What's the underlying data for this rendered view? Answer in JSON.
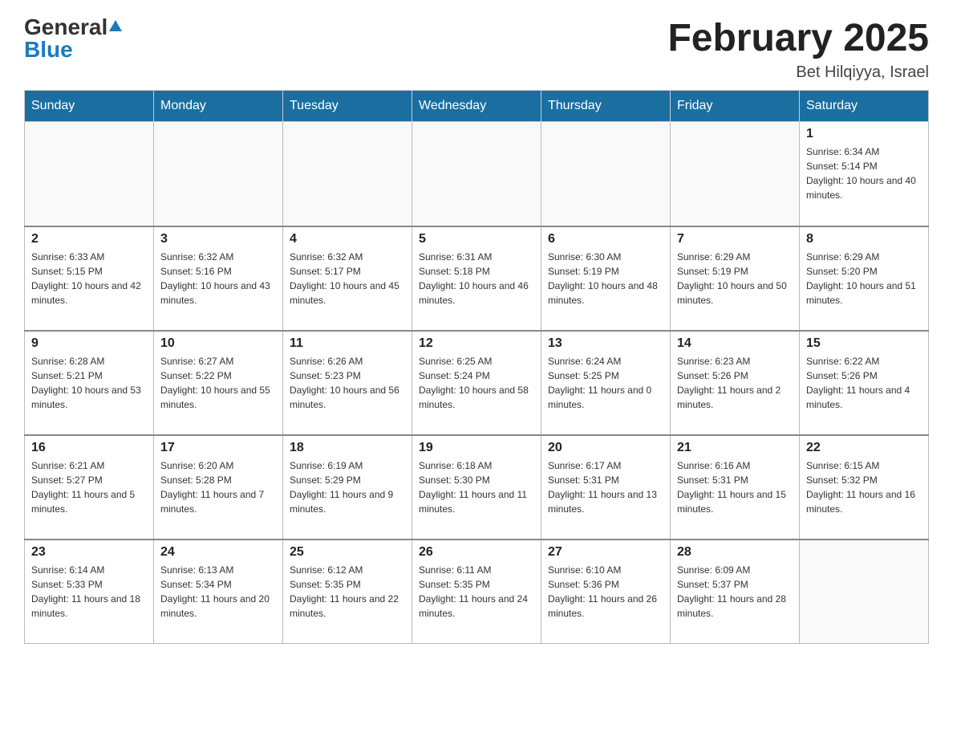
{
  "header": {
    "logo_general": "General",
    "logo_blue": "Blue",
    "month_title": "February 2025",
    "location": "Bet Hilqiyya, Israel"
  },
  "weekdays": [
    "Sunday",
    "Monday",
    "Tuesday",
    "Wednesday",
    "Thursday",
    "Friday",
    "Saturday"
  ],
  "weeks": [
    [
      {
        "day": "",
        "sunrise": "",
        "sunset": "",
        "daylight": ""
      },
      {
        "day": "",
        "sunrise": "",
        "sunset": "",
        "daylight": ""
      },
      {
        "day": "",
        "sunrise": "",
        "sunset": "",
        "daylight": ""
      },
      {
        "day": "",
        "sunrise": "",
        "sunset": "",
        "daylight": ""
      },
      {
        "day": "",
        "sunrise": "",
        "sunset": "",
        "daylight": ""
      },
      {
        "day": "",
        "sunrise": "",
        "sunset": "",
        "daylight": ""
      },
      {
        "day": "1",
        "sunrise": "Sunrise: 6:34 AM",
        "sunset": "Sunset: 5:14 PM",
        "daylight": "Daylight: 10 hours and 40 minutes."
      }
    ],
    [
      {
        "day": "2",
        "sunrise": "Sunrise: 6:33 AM",
        "sunset": "Sunset: 5:15 PM",
        "daylight": "Daylight: 10 hours and 42 minutes."
      },
      {
        "day": "3",
        "sunrise": "Sunrise: 6:32 AM",
        "sunset": "Sunset: 5:16 PM",
        "daylight": "Daylight: 10 hours and 43 minutes."
      },
      {
        "day": "4",
        "sunrise": "Sunrise: 6:32 AM",
        "sunset": "Sunset: 5:17 PM",
        "daylight": "Daylight: 10 hours and 45 minutes."
      },
      {
        "day": "5",
        "sunrise": "Sunrise: 6:31 AM",
        "sunset": "Sunset: 5:18 PM",
        "daylight": "Daylight: 10 hours and 46 minutes."
      },
      {
        "day": "6",
        "sunrise": "Sunrise: 6:30 AM",
        "sunset": "Sunset: 5:19 PM",
        "daylight": "Daylight: 10 hours and 48 minutes."
      },
      {
        "day": "7",
        "sunrise": "Sunrise: 6:29 AM",
        "sunset": "Sunset: 5:19 PM",
        "daylight": "Daylight: 10 hours and 50 minutes."
      },
      {
        "day": "8",
        "sunrise": "Sunrise: 6:29 AM",
        "sunset": "Sunset: 5:20 PM",
        "daylight": "Daylight: 10 hours and 51 minutes."
      }
    ],
    [
      {
        "day": "9",
        "sunrise": "Sunrise: 6:28 AM",
        "sunset": "Sunset: 5:21 PM",
        "daylight": "Daylight: 10 hours and 53 minutes."
      },
      {
        "day": "10",
        "sunrise": "Sunrise: 6:27 AM",
        "sunset": "Sunset: 5:22 PM",
        "daylight": "Daylight: 10 hours and 55 minutes."
      },
      {
        "day": "11",
        "sunrise": "Sunrise: 6:26 AM",
        "sunset": "Sunset: 5:23 PM",
        "daylight": "Daylight: 10 hours and 56 minutes."
      },
      {
        "day": "12",
        "sunrise": "Sunrise: 6:25 AM",
        "sunset": "Sunset: 5:24 PM",
        "daylight": "Daylight: 10 hours and 58 minutes."
      },
      {
        "day": "13",
        "sunrise": "Sunrise: 6:24 AM",
        "sunset": "Sunset: 5:25 PM",
        "daylight": "Daylight: 11 hours and 0 minutes."
      },
      {
        "day": "14",
        "sunrise": "Sunrise: 6:23 AM",
        "sunset": "Sunset: 5:26 PM",
        "daylight": "Daylight: 11 hours and 2 minutes."
      },
      {
        "day": "15",
        "sunrise": "Sunrise: 6:22 AM",
        "sunset": "Sunset: 5:26 PM",
        "daylight": "Daylight: 11 hours and 4 minutes."
      }
    ],
    [
      {
        "day": "16",
        "sunrise": "Sunrise: 6:21 AM",
        "sunset": "Sunset: 5:27 PM",
        "daylight": "Daylight: 11 hours and 5 minutes."
      },
      {
        "day": "17",
        "sunrise": "Sunrise: 6:20 AM",
        "sunset": "Sunset: 5:28 PM",
        "daylight": "Daylight: 11 hours and 7 minutes."
      },
      {
        "day": "18",
        "sunrise": "Sunrise: 6:19 AM",
        "sunset": "Sunset: 5:29 PM",
        "daylight": "Daylight: 11 hours and 9 minutes."
      },
      {
        "day": "19",
        "sunrise": "Sunrise: 6:18 AM",
        "sunset": "Sunset: 5:30 PM",
        "daylight": "Daylight: 11 hours and 11 minutes."
      },
      {
        "day": "20",
        "sunrise": "Sunrise: 6:17 AM",
        "sunset": "Sunset: 5:31 PM",
        "daylight": "Daylight: 11 hours and 13 minutes."
      },
      {
        "day": "21",
        "sunrise": "Sunrise: 6:16 AM",
        "sunset": "Sunset: 5:31 PM",
        "daylight": "Daylight: 11 hours and 15 minutes."
      },
      {
        "day": "22",
        "sunrise": "Sunrise: 6:15 AM",
        "sunset": "Sunset: 5:32 PM",
        "daylight": "Daylight: 11 hours and 16 minutes."
      }
    ],
    [
      {
        "day": "23",
        "sunrise": "Sunrise: 6:14 AM",
        "sunset": "Sunset: 5:33 PM",
        "daylight": "Daylight: 11 hours and 18 minutes."
      },
      {
        "day": "24",
        "sunrise": "Sunrise: 6:13 AM",
        "sunset": "Sunset: 5:34 PM",
        "daylight": "Daylight: 11 hours and 20 minutes."
      },
      {
        "day": "25",
        "sunrise": "Sunrise: 6:12 AM",
        "sunset": "Sunset: 5:35 PM",
        "daylight": "Daylight: 11 hours and 22 minutes."
      },
      {
        "day": "26",
        "sunrise": "Sunrise: 6:11 AM",
        "sunset": "Sunset: 5:35 PM",
        "daylight": "Daylight: 11 hours and 24 minutes."
      },
      {
        "day": "27",
        "sunrise": "Sunrise: 6:10 AM",
        "sunset": "Sunset: 5:36 PM",
        "daylight": "Daylight: 11 hours and 26 minutes."
      },
      {
        "day": "28",
        "sunrise": "Sunrise: 6:09 AM",
        "sunset": "Sunset: 5:37 PM",
        "daylight": "Daylight: 11 hours and 28 minutes."
      },
      {
        "day": "",
        "sunrise": "",
        "sunset": "",
        "daylight": ""
      }
    ]
  ]
}
